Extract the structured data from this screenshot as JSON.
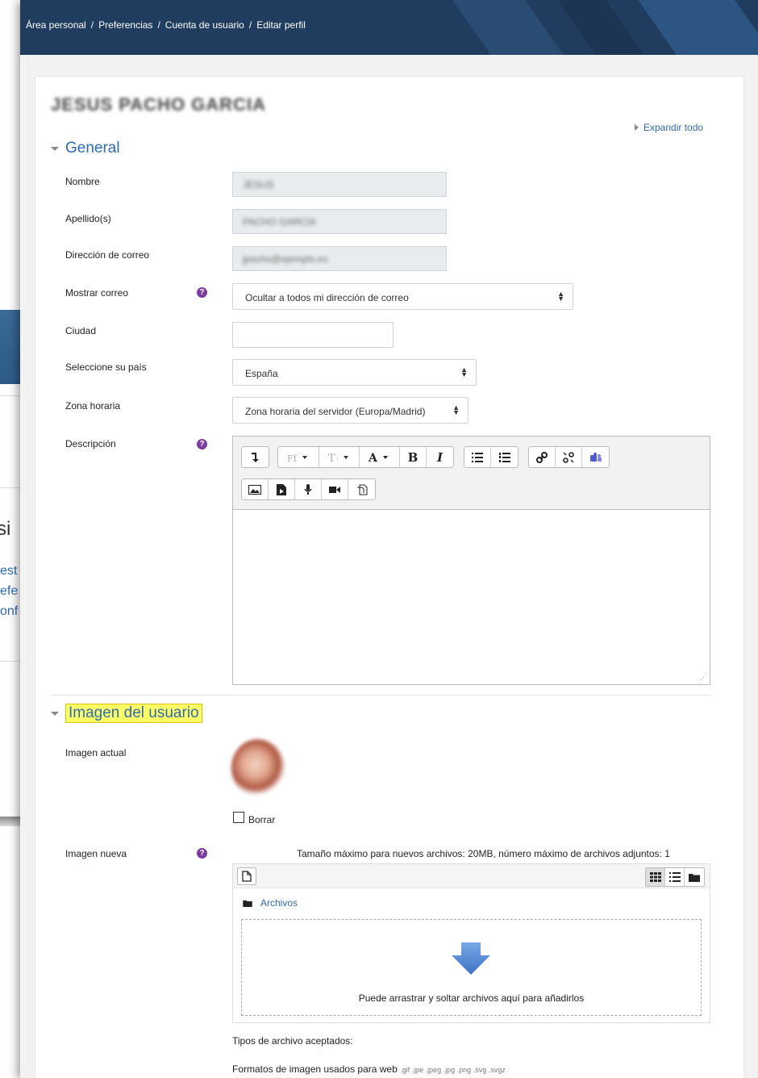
{
  "breadcrumb": {
    "items": [
      "Área personal",
      "Preferencias",
      "Cuenta de usuario",
      "Editar perfil"
    ],
    "separator": "/"
  },
  "profile": {
    "user_name": "JESUS PACHO GARCIA",
    "expand_all": "Expandir todo"
  },
  "general": {
    "title": "General",
    "fields": {
      "nombre": {
        "label": "Nombre",
        "value": "JESUS"
      },
      "apellidos": {
        "label": "Apellido(s)",
        "value": "PACHO GARCIA"
      },
      "correo": {
        "label": "Dirección de correo",
        "value": "jpacho@ejemplo.es"
      },
      "mostrar_correo": {
        "label": "Mostrar correo",
        "value": "Ocultar a todos mi dirección de correo"
      },
      "ciudad": {
        "label": "Ciudad",
        "value": ""
      },
      "pais": {
        "label": "Seleccione su país",
        "value": "España"
      },
      "zona_horaria": {
        "label": "Zona horaria",
        "value": "Zona horaria del servidor (Europa/Madrid)"
      },
      "descripcion": {
        "label": "Descripción"
      }
    },
    "help_glyph": "?"
  },
  "editor_toolbar": {
    "row1": [
      "collapse-icon",
      "font-family-icon",
      "font-size-icon",
      "font-color-icon",
      "bold-icon",
      "italic-icon",
      "unordered-list-icon",
      "ordered-list-icon",
      "link-icon",
      "unlink-icon",
      "teams-icon"
    ],
    "row2": [
      "image-icon",
      "media-icon",
      "record-audio-icon",
      "record-video-icon",
      "manage-files-icon"
    ],
    "bold": "B",
    "italic": "I",
    "font_color": "A"
  },
  "user_image": {
    "title": "Imagen del usuario",
    "current_label": "Imagen actual",
    "delete_label": "Borrar",
    "new_label": "Imagen nueva",
    "max_size": "Tamaño máximo para nuevos archivos: 20MB, número máximo de archivos adjuntos: 1",
    "folder": "Archivos",
    "drop_text": "Puede arrastrar y soltar archivos aquí para añadirlos",
    "accepted_label": "Tipos de archivo aceptados:",
    "formats_label": "Formatos de imagen usados para web",
    "formats_ext": ".gif .jpe .jpeg .jpg .png .svg .svgz"
  },
  "background_window": {
    "title_fragment": "si",
    "link_fragments": [
      "est",
      "efe",
      "onf"
    ]
  },
  "colors": {
    "topbar": "#203c5e",
    "link": "#2f6bb0",
    "help": "#7d3a9f",
    "highlight": "#ffff66",
    "drop_arrow": "#5b8fd6"
  }
}
